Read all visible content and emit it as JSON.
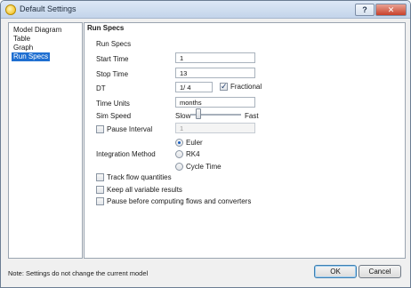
{
  "window": {
    "title": "Default Settings",
    "help_label": "?",
    "close_label": "✕"
  },
  "sidebar": {
    "items": [
      {
        "label": "Model Diagram",
        "selected": false
      },
      {
        "label": "Table",
        "selected": false
      },
      {
        "label": "Graph",
        "selected": false
      },
      {
        "label": "Run Specs",
        "selected": true
      }
    ]
  },
  "panel": {
    "title": "Run Specs",
    "section_label": "Run Specs",
    "start_time": {
      "label": "Start Time",
      "value": "1"
    },
    "stop_time": {
      "label": "Stop Time",
      "value": "13"
    },
    "dt": {
      "label": "DT",
      "value": "1/ 4",
      "fractional_label": "Fractional",
      "fractional_checked": true
    },
    "time_units": {
      "label": "Time Units",
      "value": "months"
    },
    "sim_speed": {
      "label": "Sim Speed",
      "slow_label": "Slow",
      "fast_label": "Fast",
      "level": 0.12
    },
    "pause_interval": {
      "label": "Pause Interval",
      "value": "1",
      "checked": false
    },
    "integration": {
      "label": "Integration Method",
      "options": [
        "Euler",
        "RK4",
        "Cycle Time"
      ],
      "selected": "Euler"
    },
    "track_flow": {
      "label": "Track flow quantities",
      "checked": false
    },
    "keep_results": {
      "label": "Keep all variable results",
      "checked": false
    },
    "pause_before": {
      "label": "Pause before computing flows and converters",
      "checked": false
    }
  },
  "footer": {
    "note": "Note: Settings do not change the current model",
    "ok_label": "OK",
    "cancel_label": "Cancel"
  },
  "colors": {
    "selection_bg": "#1f6fd1",
    "selection_text": "#ffffff",
    "accent": "#1a5fbf"
  }
}
